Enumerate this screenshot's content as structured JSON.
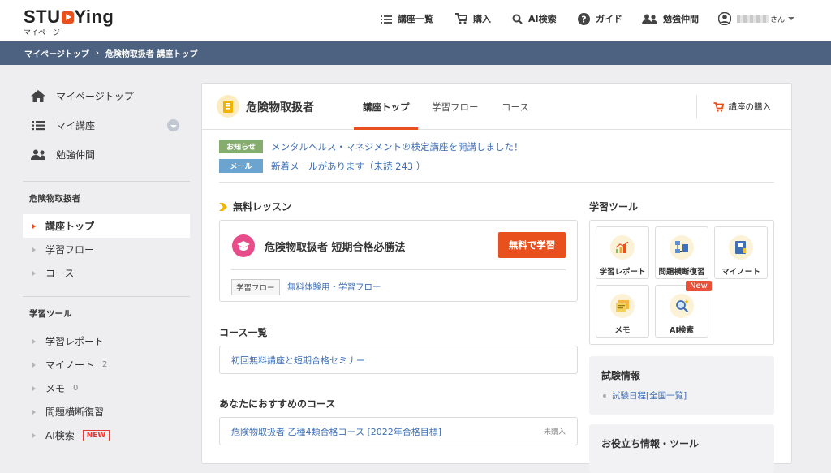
{
  "logo": {
    "text_pre": "STU",
    "text_post": "Ying",
    "sub": "マイページ"
  },
  "topnav": {
    "courses": "講座一覧",
    "buy": "購入",
    "ai_search": "AI検索",
    "guide": "ガイド",
    "friends": "勉強仲間",
    "user_suffix": "さん"
  },
  "breadcrumb": {
    "home": "マイページトップ",
    "separator": "›",
    "current": "危険物取扱者 講座トップ"
  },
  "sidebar": {
    "mypage_top": "マイページトップ",
    "my_courses": "マイ講座",
    "friends": "勉強仲間",
    "course_section": "危険物取扱者",
    "course_items": [
      "講座トップ",
      "学習フロー",
      "コース"
    ],
    "tools_section": "学習ツール",
    "tools": {
      "report": "学習レポート",
      "notebook": "マイノート",
      "notebook_count": "2",
      "memo": "メモ",
      "memo_count": "0",
      "review": "問題横断復習",
      "ai": "AI検索",
      "ai_badge": "NEW"
    }
  },
  "panel": {
    "course_title": "危険物取扱者",
    "tabs": [
      "講座トップ",
      "学習フロー",
      "コース"
    ],
    "buy_label": "講座の購入",
    "notices": [
      {
        "badge": "お知らせ",
        "color": "#85ad6e",
        "text": "メンタルヘルス・マネジメント®検定講座を開講しました！"
      },
      {
        "badge": "メール",
        "color": "#6aa4cf",
        "text": "新着メールがあります（未読 243 ）"
      }
    ],
    "free_lesson": {
      "section": "無料レッスン",
      "title": "危険物取扱者 短期合格必勝法",
      "button": "無料で学習",
      "flow_tag": "学習フロー",
      "flow_link": "無料体験用・学習フロー"
    },
    "course_list": {
      "section": "コース一覧",
      "item": "初回無料講座と短期合格セミナー"
    },
    "recommend": {
      "section": "あなたにおすすめのコース",
      "item": "危険物取扱者 乙種4類合格コース [2022年合格目標]",
      "status": "未購入"
    },
    "tools": {
      "section": "学習ツール",
      "items": [
        "学習レポート",
        "問題横断復習",
        "マイノート",
        "メモ",
        "AI検索"
      ],
      "new_badge": "New"
    },
    "exam": {
      "title": "試験情報",
      "link": "試験日程[全国一覧]"
    },
    "useful": {
      "title": "お役立ち情報・ツール"
    }
  },
  "colors": {
    "accent": "#e8501e",
    "header": "#4c6280",
    "link": "#3d6fb6"
  }
}
